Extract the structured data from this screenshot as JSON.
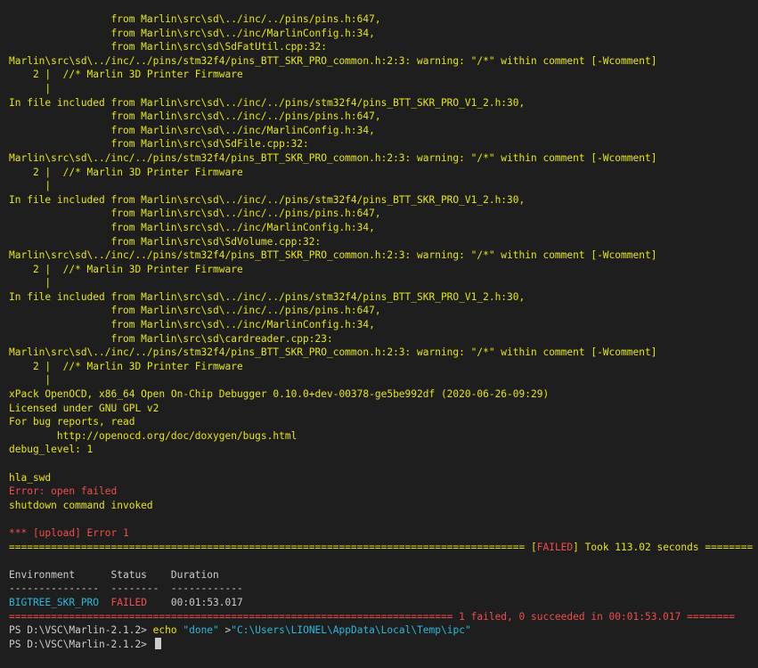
{
  "terminal": {
    "lines": [
      {
        "cls": "yellow",
        "text": "                 from Marlin\\src\\sd\\../inc/../pins/pins.h:647,"
      },
      {
        "cls": "yellow",
        "text": "                 from Marlin\\src\\sd\\../inc/MarlinConfig.h:34,"
      },
      {
        "cls": "yellow",
        "text": "                 from Marlin\\src\\sd\\SdFatUtil.cpp:32:"
      },
      {
        "cls": "yellow",
        "text": "Marlin\\src\\sd\\../inc/../pins/stm32f4/pins_BTT_SKR_PRO_common.h:2:3: warning: \"/*\" within comment [-Wcomment]"
      },
      {
        "cls": "yellow",
        "text": "    2 |  //* Marlin 3D Printer Firmware"
      },
      {
        "cls": "yellow",
        "text": "      |"
      },
      {
        "cls": "yellow",
        "text": "In file included from Marlin\\src\\sd\\../inc/../pins/stm32f4/pins_BTT_SKR_PRO_V1_2.h:30,"
      },
      {
        "cls": "yellow",
        "text": "                 from Marlin\\src\\sd\\../inc/../pins/pins.h:647,"
      },
      {
        "cls": "yellow",
        "text": "                 from Marlin\\src\\sd\\../inc/MarlinConfig.h:34,"
      },
      {
        "cls": "yellow",
        "text": "                 from Marlin\\src\\sd\\SdFile.cpp:32:"
      },
      {
        "cls": "yellow",
        "text": "Marlin\\src\\sd\\../inc/../pins/stm32f4/pins_BTT_SKR_PRO_common.h:2:3: warning: \"/*\" within comment [-Wcomment]"
      },
      {
        "cls": "yellow",
        "text": "    2 |  //* Marlin 3D Printer Firmware"
      },
      {
        "cls": "yellow",
        "text": "      |"
      },
      {
        "cls": "yellow",
        "text": "In file included from Marlin\\src\\sd\\../inc/../pins/stm32f4/pins_BTT_SKR_PRO_V1_2.h:30,"
      },
      {
        "cls": "yellow",
        "text": "                 from Marlin\\src\\sd\\../inc/../pins/pins.h:647,"
      },
      {
        "cls": "yellow",
        "text": "                 from Marlin\\src\\sd\\../inc/MarlinConfig.h:34,"
      },
      {
        "cls": "yellow",
        "text": "                 from Marlin\\src\\sd\\SdVolume.cpp:32:"
      },
      {
        "cls": "yellow",
        "text": "Marlin\\src\\sd\\../inc/../pins/stm32f4/pins_BTT_SKR_PRO_common.h:2:3: warning: \"/*\" within comment [-Wcomment]"
      },
      {
        "cls": "yellow",
        "text": "    2 |  //* Marlin 3D Printer Firmware"
      },
      {
        "cls": "yellow",
        "text": "      |"
      },
      {
        "cls": "yellow",
        "text": "In file included from Marlin\\src\\sd\\../inc/../pins/stm32f4/pins_BTT_SKR_PRO_V1_2.h:30,"
      },
      {
        "cls": "yellow",
        "text": "                 from Marlin\\src\\sd\\../inc/../pins/pins.h:647,"
      },
      {
        "cls": "yellow",
        "text": "                 from Marlin\\src\\sd\\../inc/MarlinConfig.h:34,"
      },
      {
        "cls": "yellow",
        "text": "                 from Marlin\\src\\sd\\cardreader.cpp:23:"
      },
      {
        "cls": "yellow",
        "text": "Marlin\\src\\sd\\../inc/../pins/stm32f4/pins_BTT_SKR_PRO_common.h:2:3: warning: \"/*\" within comment [-Wcomment]"
      },
      {
        "cls": "yellow",
        "text": "    2 |  //* Marlin 3D Printer Firmware"
      },
      {
        "cls": "yellow",
        "text": "      |"
      },
      {
        "cls": "yellow",
        "text": "xPack OpenOCD, x86_64 Open On-Chip Debugger 0.10.0+dev-00378-ge5be992df (2020-06-26-09:29)"
      },
      {
        "cls": "yellow",
        "text": "Licensed under GNU GPL v2"
      },
      {
        "cls": "yellow",
        "text": "For bug reports, read"
      },
      {
        "cls": "yellow",
        "text": "        http://openocd.org/doc/doxygen/bugs.html"
      },
      {
        "cls": "yellow",
        "text": "debug_level: 1"
      },
      {
        "cls": "yellow",
        "text": ""
      },
      {
        "cls": "yellow",
        "text": "hla_swd"
      },
      {
        "cls": "red",
        "text": "Error: open failed"
      },
      {
        "cls": "yellow",
        "text": "shutdown command invoked"
      },
      {
        "cls": "yellow",
        "text": ""
      },
      {
        "cls": "red",
        "text": "*** [upload] Error 1"
      }
    ],
    "failed_rule": {
      "prefix": "====================================================================================== [",
      "status": "FAILED",
      "suffix": "] Took 113.02 seconds ========"
    },
    "summary_header": "Environment      Status    Duration",
    "summary_dashes": "---------------  --------  ------------",
    "summary_row": {
      "env": "BIGTREE_SKR_PRO",
      "status": "FAILED",
      "duration": "00:01:53.017"
    },
    "final_rule": "========================================================================== 1 failed, 0 succeeded in 00:01:53.017 ========",
    "prompt1": {
      "prompt": "PS D:\\VSC\\Marlin-2.1.2> ",
      "cmd": "echo",
      "arg1": "\"done\"",
      "redirect": " >",
      "arg2": "\"C:\\Users\\LIONEL\\AppData\\Local\\Temp\\ipc\""
    },
    "prompt2": "PS D:\\VSC\\Marlin-2.1.2> "
  },
  "colors": {
    "background": "#1e1e1e",
    "yellow": "#e5e510",
    "red": "#f14c4c",
    "cyan": "#29b8db",
    "text": "#cccccc"
  }
}
